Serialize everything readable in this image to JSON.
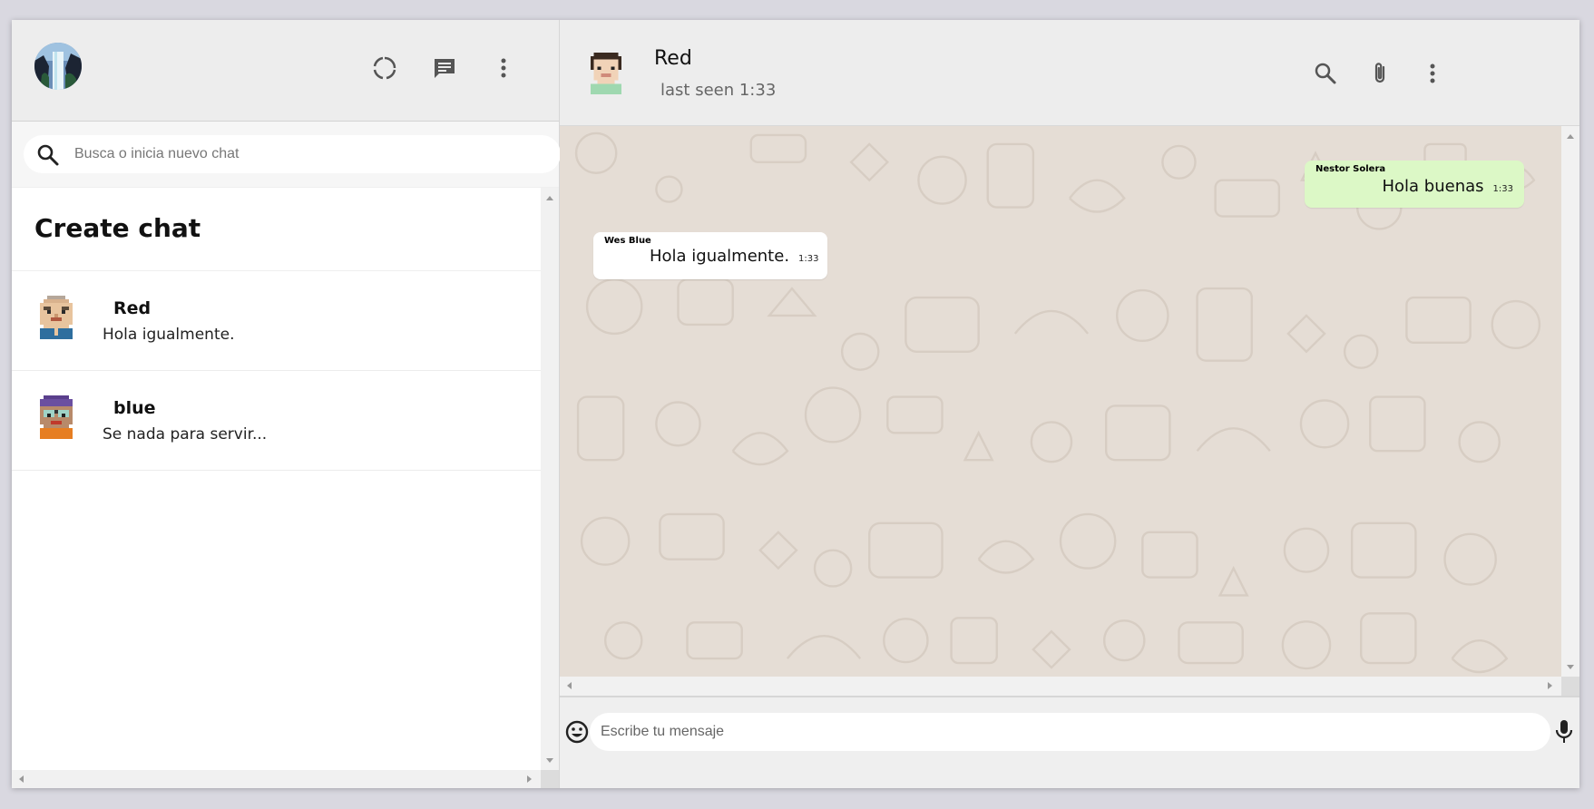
{
  "sidebar": {
    "search": {
      "placeholder": "Busca o inicia nuevo chat"
    },
    "create_chat_label": "Create chat",
    "chats": [
      {
        "name": "Red",
        "preview": "Hola igualmente."
      },
      {
        "name": "blue",
        "preview": "Se nada para servir..."
      }
    ],
    "icons": [
      "status-icon",
      "new-chat-icon",
      "menu-icon"
    ]
  },
  "conversation": {
    "contact_name": "Red",
    "last_seen": "last seen 1:33",
    "messages": [
      {
        "direction": "outgoing",
        "sender": "Nestor Solera",
        "text": "Hola buenas",
        "time": "1:33"
      },
      {
        "direction": "incoming",
        "sender": "Wes Blue",
        "text": "Hola igualmente.",
        "time": "1:33"
      }
    ],
    "header_icons": [
      "search-icon",
      "attach-icon",
      "menu-icon"
    ]
  },
  "composer": {
    "placeholder": "Escribe tu mensaje",
    "icons": [
      "emoji-icon",
      "mic-icon"
    ]
  },
  "colors": {
    "chat_background": "#e5ddd5",
    "outgoing_bubble": "#dcf8c6",
    "incoming_bubble": "#ffffff",
    "header_background": "#ededed"
  }
}
